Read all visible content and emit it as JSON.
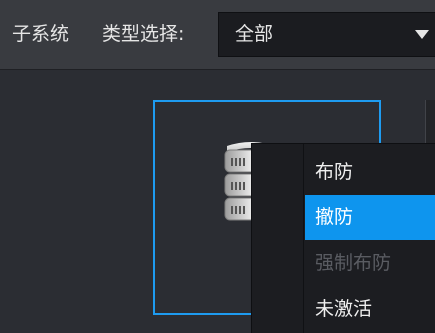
{
  "filter_bar": {
    "subsystem_label": "子系统",
    "type_label": "类型选择:",
    "type_select": {
      "selected": "全部",
      "caret_icon": "caret-down-icon"
    }
  },
  "device": {
    "icon": "server-icon",
    "selected": true
  },
  "context_menu": {
    "items": [
      {
        "label": "布防",
        "state": "normal"
      },
      {
        "label": "撤防",
        "state": "highlighted"
      },
      {
        "label": "强制布防",
        "state": "disabled"
      },
      {
        "label": "未激活",
        "state": "normal"
      }
    ]
  },
  "colors": {
    "accent": "#1e9bf0",
    "menu_highlight": "#0e95ee",
    "background": "#2b2d33",
    "topbar": "#393b40",
    "menu_background": "#1c1d21",
    "disabled_text": "#5a5c62"
  }
}
